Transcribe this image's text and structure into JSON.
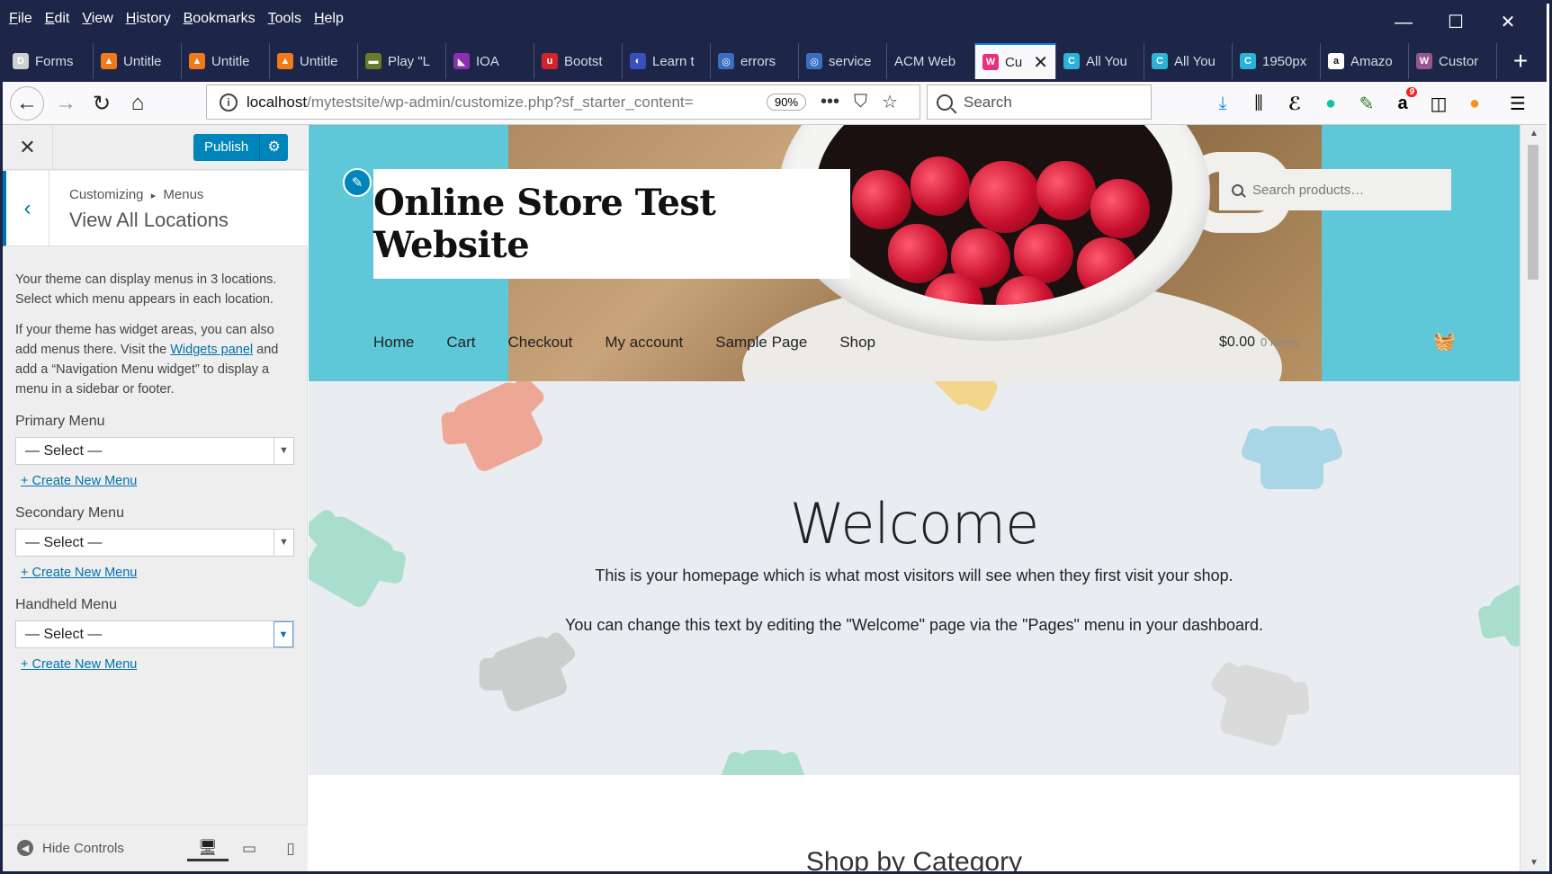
{
  "menubar": [
    {
      "key": "F",
      "rest": "ile"
    },
    {
      "key": "E",
      "rest": "dit"
    },
    {
      "key": "V",
      "rest": "iew"
    },
    {
      "key": "H",
      "rest": "istory"
    },
    {
      "key": "B",
      "rest": "ookmarks"
    },
    {
      "key": "T",
      "rest": "ools"
    },
    {
      "key": "H",
      "rest": "elp"
    }
  ],
  "window_controls": {
    "minimize": "—",
    "maximize": "☐",
    "close": "✕"
  },
  "tabs": [
    {
      "label": "Forms",
      "fav": "D",
      "color": "#cfcfcf",
      "active": false
    },
    {
      "label": "Untitle",
      "fav": "▲",
      "color": "#f07a1a",
      "active": false
    },
    {
      "label": "Untitle",
      "fav": "▲",
      "color": "#f07a1a",
      "active": false
    },
    {
      "label": "Untitle",
      "fav": "▲",
      "color": "#f07a1a",
      "active": false
    },
    {
      "label": "Play \"L",
      "fav": "▬",
      "color": "#6b7a2a",
      "active": false
    },
    {
      "label": "IOA",
      "fav": "◣",
      "color": "#8b2fb0",
      "active": false
    },
    {
      "label": "Bootst",
      "fav": "u",
      "color": "#d2232a",
      "active": false
    },
    {
      "label": "Learn t",
      "fav": "◐",
      "color": "#3a4fbf",
      "active": false
    },
    {
      "label": "errors",
      "fav": "◎",
      "color": "#3a6fbf",
      "active": false
    },
    {
      "label": "service",
      "fav": "◎",
      "color": "#3a6fbf",
      "active": false
    },
    {
      "label": "ACM Web",
      "fav": "",
      "color": "transparent",
      "active": false
    },
    {
      "label": "Cu",
      "fav": "W",
      "color": "#e6317c",
      "active": true
    },
    {
      "label": "All You",
      "fav": "C",
      "color": "#2bb3d6",
      "active": false
    },
    {
      "label": "All You",
      "fav": "C",
      "color": "#2bb3d6",
      "active": false
    },
    {
      "label": "1950px",
      "fav": "C",
      "color": "#2bb3d6",
      "active": false
    },
    {
      "label": "Amazo",
      "fav": "a",
      "color": "#ffffff",
      "active": false
    },
    {
      "label": "Custor",
      "fav": "W",
      "color": "#96588a",
      "active": false
    }
  ],
  "new_tab": "+",
  "url": {
    "host": "localhost",
    "path": "/mytestsite/wp-admin/customize.php?sf_starter_content=",
    "zoom": "90%",
    "more": "•••"
  },
  "search_placeholder": "Search",
  "toolbar_badge": "9",
  "customizer": {
    "publish_label": "Publish",
    "breadcrumb_parent": "Customizing",
    "breadcrumb_current": "Menus",
    "breadcrumb_sep": "▸",
    "title": "View All Locations",
    "intro_1": "Your theme can display menus in 3 locations. Select which menu appears in each location.",
    "intro_2_before": "If your theme has widget areas, you can also add menus there. Visit the ",
    "intro_2_link": "Widgets panel",
    "intro_2_after": " and add a “Navigation Menu widget” to display a menu in a sidebar or footer.",
    "locations": [
      {
        "label": "Primary Menu",
        "value": "— Select —",
        "create": "+ Create New Menu"
      },
      {
        "label": "Secondary Menu",
        "value": "— Select —",
        "create": "+ Create New Menu"
      },
      {
        "label": "Handheld Menu",
        "value": "— Select —",
        "create": "+ Create New Menu"
      }
    ],
    "hide_controls": "Hide Controls"
  },
  "preview": {
    "site_title": "Online Store Test Website",
    "search_placeholder": "Search products…",
    "nav": [
      "Home",
      "Cart",
      "Checkout",
      "My account",
      "Sample Page",
      "Shop"
    ],
    "cart_total": "$0.00",
    "cart_items": "0 items",
    "welcome_heading": "Welcome",
    "welcome_line_1": "This is your homepage which is what most visitors will see when they first visit your shop.",
    "welcome_line_2": "You can change this text by editing the \"Welcome\" page via the \"Pages\" menu in your dashboard.",
    "section_heading": "Shop by Category"
  },
  "colors": {
    "chrome": "#1d2648",
    "wp_blue": "#0085ba",
    "header_teal": "#5ec8d8",
    "hero_bg": "#e9ecf0"
  }
}
